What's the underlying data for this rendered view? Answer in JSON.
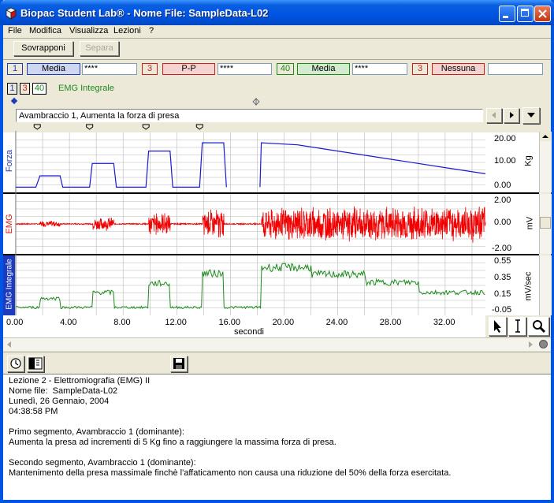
{
  "window": {
    "title": "Biopac Student Lab® - Nome File: SampleData-L02"
  },
  "menu": [
    "File",
    "Modifica",
    "Visualizza",
    "Lezioni",
    "?"
  ],
  "toolbar": {
    "overlay_label": "Sovrapponi",
    "separate_label": "Separa"
  },
  "measurements": [
    {
      "channel": "1",
      "type": "Media",
      "value": "****",
      "color": "#1d3bbf",
      "fill": "#cfd6f2"
    },
    {
      "channel": "3",
      "type": "P-P",
      "value": "****",
      "color": "#cc2020",
      "fill": "#f5d3d0"
    },
    {
      "channel": "40",
      "type": "Media",
      "value": "****",
      "color": "#1e8a1e",
      "fill": "#d3ecd0"
    },
    {
      "channel": "3",
      "type": "Nessuna",
      "value": "",
      "color": "#cc2020",
      "fill": "#f5d3d0"
    }
  ],
  "channel_select": {
    "buttons": [
      "1",
      "3",
      "40"
    ],
    "label": "EMG Integrale",
    "label_color": "#1e8a1e"
  },
  "markers": {
    "current": "Avambraccio 1, Aumenta la forza di presa"
  },
  "chart_data": [
    {
      "type": "line",
      "name": "Forza",
      "ylabel": "Kg",
      "yticks": [
        "20.00",
        "10.00",
        "0.00"
      ],
      "ylim": [
        -2,
        27
      ],
      "color": "#1a1ad0",
      "segments": [
        [
          [
            0,
            0.5
          ],
          [
            1.5,
            0.5
          ],
          [
            1.8,
            6
          ],
          [
            3.3,
            6
          ],
          [
            3.5,
            0.5
          ],
          [
            5.5,
            0.5
          ],
          [
            5.7,
            12
          ],
          [
            7.3,
            12
          ],
          [
            7.5,
            0.5
          ],
          [
            9.7,
            0.5
          ],
          [
            9.9,
            18
          ],
          [
            11.5,
            18
          ],
          [
            11.7,
            0.5
          ],
          [
            13.7,
            0.5
          ],
          [
            13.9,
            22
          ],
          [
            15.5,
            22
          ],
          [
            15.7,
            0.5
          ]
        ],
        [
          [
            18.2,
            0.5
          ],
          [
            18.3,
            22
          ],
          [
            21,
            21
          ],
          [
            24,
            18
          ],
          [
            28,
            14
          ],
          [
            32,
            10
          ],
          [
            35,
            7
          ]
        ]
      ]
    },
    {
      "type": "line",
      "name": "EMG",
      "ylabel": "mV",
      "yticks": [
        "2.00",
        "0.00",
        "-2.00"
      ],
      "ylim": [
        -2.5,
        2.5
      ],
      "color": "#f00000",
      "bursts": [
        [
          1.8,
          3.3,
          0.3
        ],
        [
          5.7,
          7.3,
          0.6
        ],
        [
          9.9,
          11.5,
          1.0
        ],
        [
          13.9,
          15.5,
          1.4
        ],
        [
          18.3,
          35,
          1.6
        ]
      ]
    },
    {
      "type": "line",
      "name": "EMG Integrale",
      "ylabel": "mV/sec",
      "yticks": [
        "0.55",
        "0.35",
        "0.15",
        "-0.05"
      ],
      "ylim": [
        -0.05,
        0.55
      ],
      "color": "#1e8a1e",
      "levels": [
        [
          0,
          1.8,
          0.03
        ],
        [
          1.8,
          3.3,
          0.12
        ],
        [
          3.3,
          5.7,
          0.03
        ],
        [
          5.7,
          7.3,
          0.18
        ],
        [
          7.3,
          9.9,
          0.03
        ],
        [
          9.9,
          11.5,
          0.27
        ],
        [
          11.5,
          13.9,
          0.03
        ],
        [
          13.9,
          15.5,
          0.37
        ],
        [
          15.5,
          18.3,
          0.03
        ],
        [
          18.3,
          22,
          0.43
        ],
        [
          22,
          26,
          0.36
        ],
        [
          26,
          30,
          0.28
        ],
        [
          30,
          35,
          0.18
        ]
      ]
    }
  ],
  "xaxis": {
    "label": "secondi",
    "ticks": [
      "0.00",
      "4.00",
      "8.00",
      "12.00",
      "16.00",
      "20.00",
      "24.00",
      "28.00",
      "32.00"
    ],
    "xlim": [
      0,
      35
    ]
  },
  "journal": {
    "lines": [
      "Lezione 2 - Elettromiografia (EMG) II",
      "Nome file:  SampleData-L02",
      "Lunedì, 26 Gennaio, 2004",
      "04:38:58 PM",
      "",
      "Primo segmento, Avambraccio 1 (dominante):",
      "Aumenta la presa ad incrementi di 5 Kg fino a raggiungere la massima forza di presa.",
      "",
      "Secondo segmento, Avambraccio 1 (dominante):",
      "Mantenimento della presa massimale finchè l'affaticamento non causa una riduzione del 50% della forza esercitata."
    ]
  }
}
